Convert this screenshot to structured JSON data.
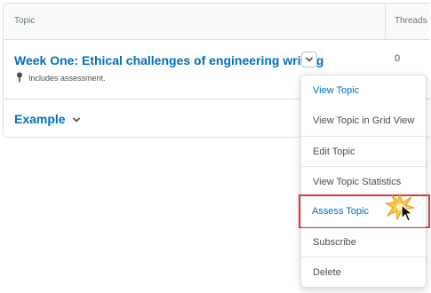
{
  "table": {
    "headers": {
      "topic": "Topic",
      "threads": "Threads"
    },
    "rows": [
      {
        "topic": "Week One: Ethical challenges of engineering writing",
        "note": "Includes assessment.",
        "threads": "0"
      }
    ],
    "categories": [
      {
        "label": "Example"
      }
    ]
  },
  "context_menu": {
    "items": [
      {
        "label": "View Topic"
      },
      {
        "label": "View Topic in Grid View"
      },
      {
        "label": "Edit Topic"
      },
      {
        "label": "View Topic Statistics"
      },
      {
        "label": "Assess Topic"
      },
      {
        "label": "Subscribe"
      },
      {
        "label": "Delete"
      }
    ],
    "highlighted": "Assess Topic"
  },
  "colors": {
    "link": "#006fbf",
    "text": "#494c4e",
    "highlight_border": "#d93e3e",
    "border": "#dcdde1"
  },
  "icons": {
    "row_context": "chevron-down-icon",
    "assessment": "pin-icon",
    "cursor": "mouse-pointer-icon",
    "click_marker": "starburst-icon"
  }
}
